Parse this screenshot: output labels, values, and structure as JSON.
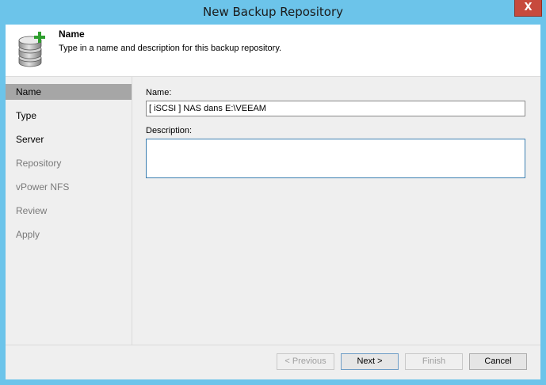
{
  "window": {
    "title": "New Backup Repository",
    "close_glyph": "X"
  },
  "header": {
    "icon": "database-add-icon",
    "title": "Name",
    "description": "Type in a name and description for this backup repository."
  },
  "sidebar": {
    "items": [
      {
        "label": "Name",
        "state": "selected"
      },
      {
        "label": "Type",
        "state": "enabled"
      },
      {
        "label": "Server",
        "state": "enabled"
      },
      {
        "label": "Repository",
        "state": "disabled"
      },
      {
        "label": "vPower NFS",
        "state": "disabled"
      },
      {
        "label": "Review",
        "state": "disabled"
      },
      {
        "label": "Apply",
        "state": "disabled"
      }
    ]
  },
  "form": {
    "name_label": "Name:",
    "name_value": "[ iSCSI ] NAS dans E:\\VEEAM",
    "description_label": "Description:",
    "description_value": ""
  },
  "buttons": {
    "previous": "< Previous",
    "next": "Next >",
    "finish": "Finish",
    "cancel": "Cancel"
  },
  "colors": {
    "window_frame": "#6cc4ea",
    "close_button": "#c74a3d",
    "selected_nav": "#a6a6a6",
    "icon_plus": "#2e9e2e"
  }
}
